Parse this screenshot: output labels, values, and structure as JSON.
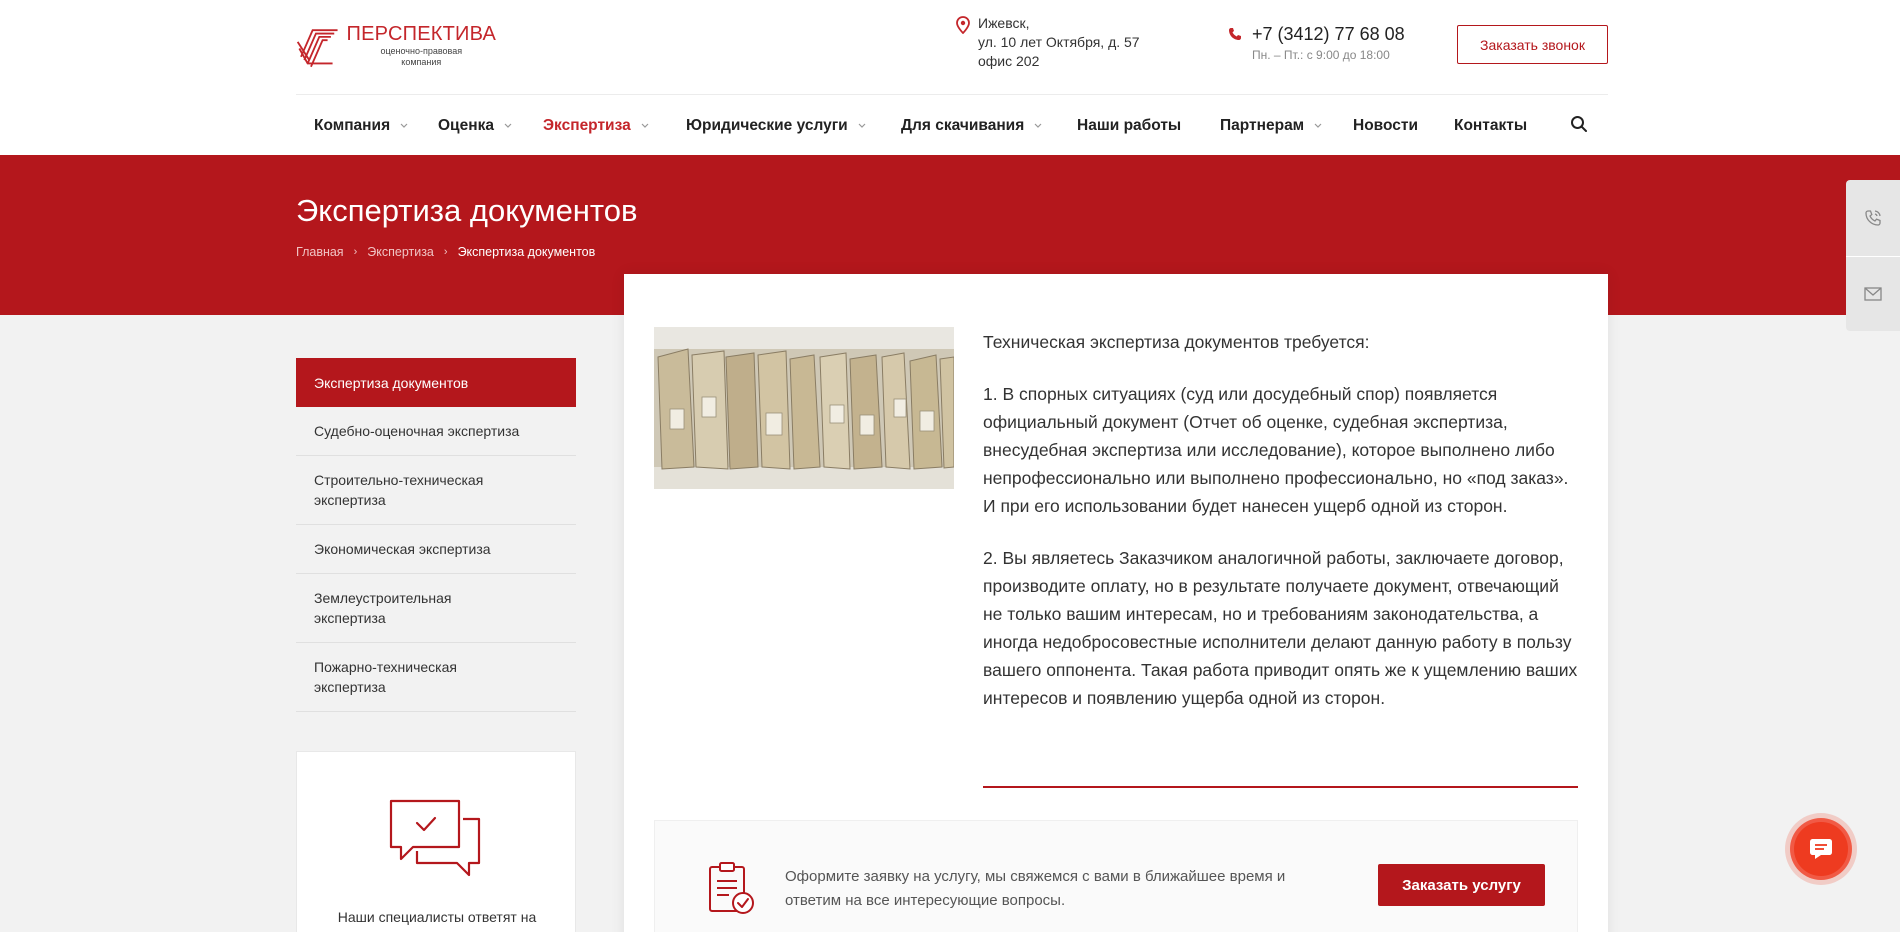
{
  "brand": {
    "name": "ПЕРСПЕКТИВА",
    "tagline_line1": "оценочно-правовая",
    "tagline_line2": "компания",
    "accent_color": "#b4171c"
  },
  "contacts": {
    "address_line1": "Ижевск,",
    "address_line2": "ул. 10 лет Октября, д. 57",
    "address_line3": "офис 202",
    "phone": "+7 (3412) 77 68 08",
    "hours": "Пн. – Пт.: с 9:00 до 18:00",
    "call_button": "Заказать звонок"
  },
  "nav": {
    "items": [
      {
        "label": "Компания",
        "has_dropdown": true
      },
      {
        "label": "Оценка",
        "has_dropdown": true
      },
      {
        "label": "Экспертиза",
        "has_dropdown": true,
        "active": true
      },
      {
        "label": "Юридические услуги",
        "has_dropdown": true
      },
      {
        "label": "Для скачивания",
        "has_dropdown": true
      },
      {
        "label": "Наши работы",
        "has_dropdown": false
      },
      {
        "label": "Партнерам",
        "has_dropdown": true
      },
      {
        "label": "Новости",
        "has_dropdown": false
      },
      {
        "label": "Контакты",
        "has_dropdown": false
      }
    ],
    "search_icon": "search-icon"
  },
  "hero": {
    "title": "Экспертиза документов",
    "breadcrumb": [
      "Главная",
      "Экспертиза",
      "Экспертиза документов"
    ]
  },
  "sidebar": {
    "items": [
      {
        "label": "Экспертиза документов",
        "active": true
      },
      {
        "label": "Судебно-оценочная экспертиза"
      },
      {
        "label": "Строительно-техническая экспертиза"
      },
      {
        "label": "Экономическая экспертиза"
      },
      {
        "label": "Землеустроительная экспертиза"
      },
      {
        "label": "Пожарно-техническая экспертиза"
      }
    ],
    "help_text": "Наши специалисты ответят на"
  },
  "content": {
    "intro": "Техническая экспертиза документов требуется:",
    "point1": "1. В спорных ситуациях (суд или досудебный спор) появляется официальный документ (Отчет об оценке, судебная экспертиза, внесудебная экспертиза или исследование), которое выполнено либо непрофессионально или выполнено профессионально, но «под заказ». И при его использовании будет нанесен ущерб одной из сторон.",
    "point2": "2. Вы являетесь Заказчиком аналогичной работы, заключаете договор, производите оплату, но в результате получаете документ, отвечающий не только вашим интересам, но и требованиям законодательства, а иногда недобросовестные исполнители делают данную работу в пользу вашего оппонента. Такая работа приводит опять же к ущемлению ваших интересов и появлению ущерба одной из сторон."
  },
  "order": {
    "text": "Оформите заявку на услугу, мы свяжемся с вами в ближайшее время и ответим на все интересующие вопросы.",
    "button": "Заказать услугу"
  }
}
